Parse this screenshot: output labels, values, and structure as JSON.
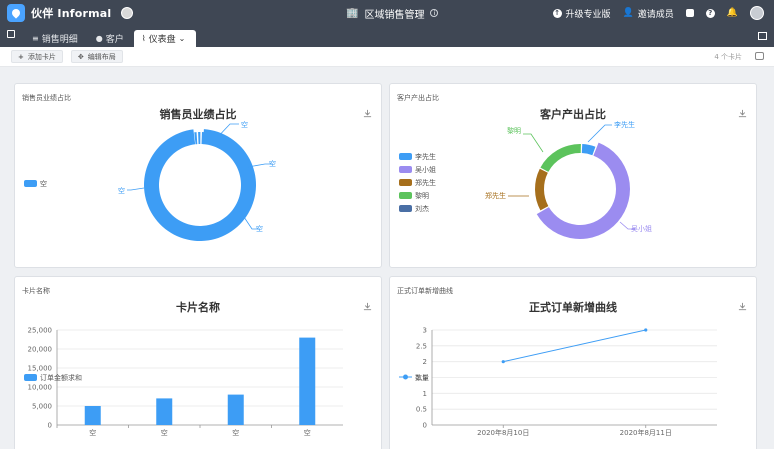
{
  "app": {
    "logo_text": "伙伴 Informal",
    "title": "区域销售管理",
    "actions": {
      "upgrade": "升级专业版",
      "invite": "邀请成员"
    }
  },
  "tabs": [
    {
      "label": "销售明细",
      "icon": "list-icon"
    },
    {
      "label": "客户",
      "icon": "user-icon"
    },
    {
      "label": "仪表盘",
      "icon": "chart-icon",
      "active": true
    }
  ],
  "toolbar": {
    "add_card": "添加卡片",
    "edit_layout": "编辑布局",
    "count": "4 个卡片"
  },
  "cards": {
    "c1": {
      "label": "销售员业绩占比",
      "title": "销售员业绩占比"
    },
    "c2": {
      "label": "客户产出占比",
      "title": "客户产出占比"
    },
    "c3": {
      "label": "卡片名称",
      "title": "卡片名称"
    },
    "c4": {
      "label": "正式订单新增曲线",
      "title": "正式订单新增曲线"
    }
  },
  "chart_data": [
    {
      "type": "pie",
      "title": "销售员业绩占比",
      "legend": [
        "空"
      ],
      "slices": [
        {
          "label": "空",
          "value": 97,
          "color": "#3d9df5"
        },
        {
          "label": "空",
          "value": 1,
          "color": "#3d9df5"
        },
        {
          "label": "空",
          "value": 1,
          "color": "#3d9df5"
        },
        {
          "label": "空",
          "value": 1,
          "color": "#3d9df5"
        }
      ]
    },
    {
      "type": "pie",
      "title": "客户产出占比",
      "legend": [
        "李先生",
        "吴小姐",
        "郑先生",
        "黎明",
        "刘杰"
      ],
      "slices": [
        {
          "label": "李先生",
          "value": 5,
          "color": "#3d9df5"
        },
        {
          "label": "吴小姐",
          "value": 58,
          "color": "#9b8cf0"
        },
        {
          "label": "郑先生",
          "value": 15,
          "color": "#a66f1c"
        },
        {
          "label": "黎明",
          "value": 17,
          "color": "#5cc35c"
        },
        {
          "label": "刘杰",
          "value": 5,
          "color": "#4a6fa5"
        }
      ]
    },
    {
      "type": "bar",
      "title": "卡片名称",
      "categories": [
        "空",
        "空",
        "空",
        "空"
      ],
      "series": [
        {
          "name": "订单金额求和",
          "values": [
            5000,
            7000,
            8000,
            23000
          ],
          "color": "#3d9df5"
        }
      ],
      "ylim": [
        0,
        25000
      ],
      "yticks": [
        "0",
        "5,000",
        "10,000",
        "15,000",
        "20,000",
        "25,000"
      ]
    },
    {
      "type": "line",
      "title": "正式订单新增曲线",
      "categories": [
        "2020年8月10日",
        "2020年8月11日"
      ],
      "series": [
        {
          "name": "数量",
          "values": [
            2,
            3
          ],
          "color": "#3d9df5"
        }
      ],
      "ylim": [
        0,
        3
      ],
      "yticks": [
        "0",
        "0.5",
        "1",
        "1.5",
        "2",
        "2.5",
        "3"
      ]
    }
  ]
}
